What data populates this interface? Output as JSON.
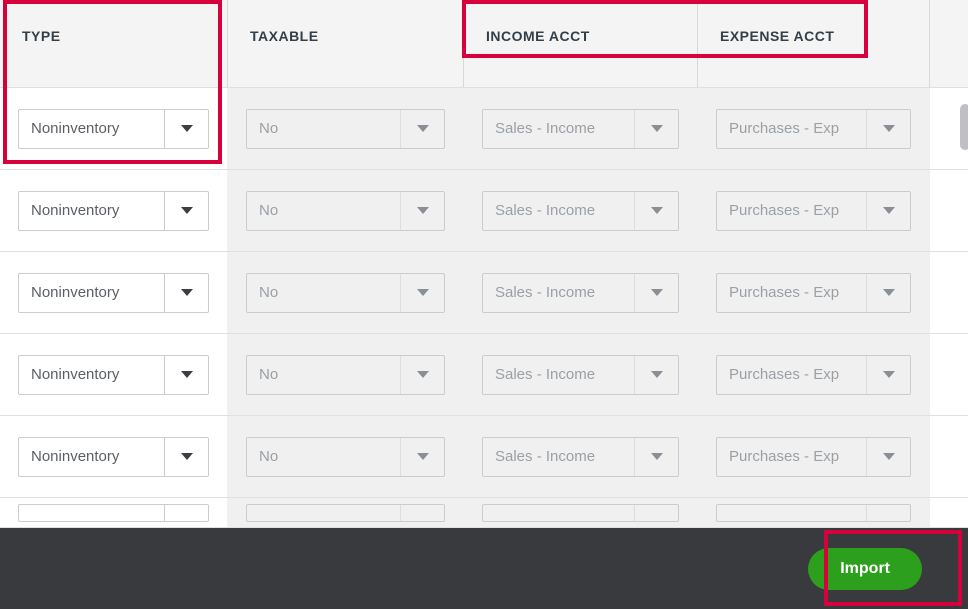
{
  "headers": {
    "type": "TYPE",
    "taxable": "TAXABLE",
    "income": "INCOME ACCT",
    "expense": "EXPENSE ACCT"
  },
  "rows": [
    {
      "type": "Noninventory",
      "taxable": "No",
      "income": "Sales - Income",
      "expense": "Purchases - Exp"
    },
    {
      "type": "Noninventory",
      "taxable": "No",
      "income": "Sales - Income",
      "expense": "Purchases - Exp"
    },
    {
      "type": "Noninventory",
      "taxable": "No",
      "income": "Sales - Income",
      "expense": "Purchases - Exp"
    },
    {
      "type": "Noninventory",
      "taxable": "No",
      "income": "Sales - Income",
      "expense": "Purchases - Exp"
    },
    {
      "type": "Noninventory",
      "taxable": "No",
      "income": "Sales - Income",
      "expense": "Purchases - Exp"
    }
  ],
  "footer": {
    "import_label": "Import"
  }
}
